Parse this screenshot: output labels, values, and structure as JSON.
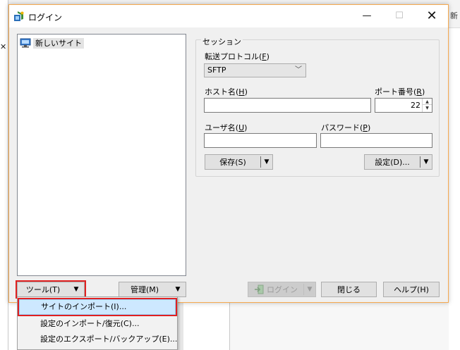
{
  "window": {
    "title": "ログイン",
    "minimize": "—",
    "maximize": "☐",
    "close": "✕"
  },
  "tree": {
    "items": [
      {
        "label": "新しいサイト"
      }
    ]
  },
  "session": {
    "legend": "セッション",
    "protocol_label": "転送プロトコル(",
    "protocol_key": "F",
    "protocol_value": "SFTP",
    "host_label": "ホスト名(",
    "host_key": "H",
    "host_value": "",
    "port_label": "ポート番号(",
    "port_key": "R",
    "port_value": "22",
    "user_label": "ユーザ名(",
    "user_key": "U",
    "user_value": "",
    "password_label": "パスワード(",
    "password_key": "P",
    "password_value": "",
    "save_label": "保存(S)",
    "advanced_label": "設定(D)..."
  },
  "buttons": {
    "tools_label": "ツール(T)",
    "manage_label": "管理(M)",
    "login_label": "ログイン",
    "close_label": "閉じる",
    "help_label": "ヘルプ(H)"
  },
  "tools_menu": {
    "items": [
      {
        "label": "サイトのインポート(I)..."
      },
      {
        "label": "設定のインポート/復元(C)..."
      },
      {
        "label": "設定のエクスポート/バックアップ(E)..."
      }
    ]
  },
  "background": {
    "left_glyph": "✕",
    "right_glyph": "新"
  },
  "colors": {
    "accent_border": "#f6a94f",
    "highlight": "#cde8ff",
    "annotation_red": "#e02020"
  }
}
